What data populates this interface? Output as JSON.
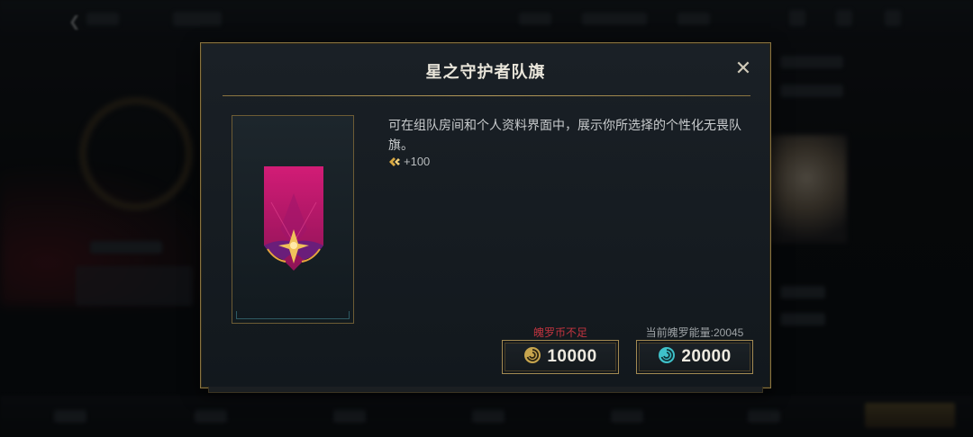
{
  "modal": {
    "title": "星之守护者队旗",
    "close_icon": "close-icon",
    "description": "可在组队房间和个人资料界面中，展示你所选择的个性化无畏队旗。",
    "reward": {
      "icon": "honor-icon",
      "text": "+100"
    },
    "purchase": {
      "coin": {
        "status": "魄罗币不足",
        "status_color": "#c2343f",
        "icon": "coin-icon",
        "price": "10000"
      },
      "energy": {
        "label": "当前魄罗能量:20045",
        "icon": "energy-icon",
        "price": "20000"
      }
    }
  },
  "colors": {
    "gold_border": "#a38a52",
    "banner": "#c21b6d",
    "warning": "#c2343f",
    "energy": "#3fc1c9"
  }
}
